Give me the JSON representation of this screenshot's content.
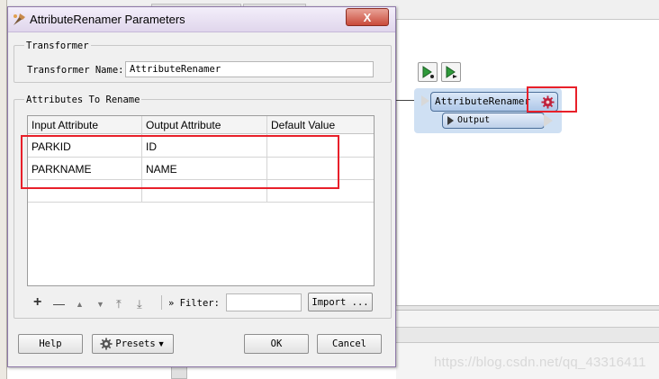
{
  "dialog": {
    "title": "AttributeRenamer Parameters",
    "close_label": "X",
    "transformer_group": {
      "label": "Transformer",
      "name_label": "Transformer Name:",
      "name_value": "AttributeRenamer"
    },
    "attributes_group": {
      "label": "Attributes To Rename",
      "columns": [
        "Input Attribute",
        "Output Attribute",
        "Default Value"
      ],
      "rows": [
        {
          "input": "PARKID",
          "output": "ID",
          "default": ""
        },
        {
          "input": "PARKNAME",
          "output": "NAME",
          "default": ""
        },
        {
          "input": "",
          "output": "",
          "default": ""
        }
      ]
    },
    "toolbar": {
      "add_icon": "+",
      "remove_icon": "—",
      "move_up_icon": "▲",
      "move_down_icon": "▼",
      "move_top_icon": "⤒",
      "move_bottom_icon": "⤓",
      "filter_label": "Filter:",
      "filter_value": "",
      "import_label": "Import ..."
    },
    "buttons": {
      "help": "Help",
      "presets": "Presets",
      "ok": "OK",
      "cancel": "Cancel"
    }
  },
  "canvas": {
    "node_title": "AttributeRenamer",
    "output_port": "Output"
  },
  "watermark": "https://blog.csdn.net/qq_43316411",
  "colors": {
    "highlight_red": "#e8202a",
    "node_blue": "#aec7e8",
    "gear_red": "#c0203a"
  }
}
